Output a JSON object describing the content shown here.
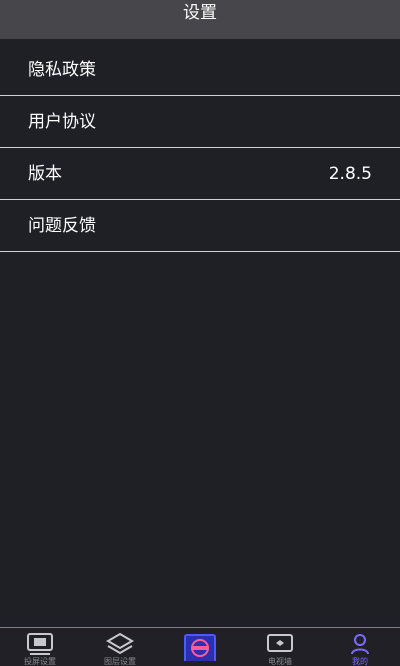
{
  "header": {
    "title": "设置"
  },
  "settings": {
    "items": [
      {
        "label": "隐私政策",
        "value": ""
      },
      {
        "label": "用户协议",
        "value": ""
      },
      {
        "label": "版本",
        "value": "2.8.5"
      },
      {
        "label": "问题反馈",
        "value": ""
      }
    ]
  },
  "tabbar": {
    "tabs": [
      {
        "label": "投屏设置",
        "icon": "screen-cast-icon",
        "active": false
      },
      {
        "label": "图层设置",
        "icon": "layers-icon",
        "active": false
      },
      {
        "label": "",
        "icon": "disc-button-icon",
        "active": false
      },
      {
        "label": "电视墙",
        "icon": "tv-wall-icon",
        "active": false
      },
      {
        "label": "我的",
        "icon": "person-icon",
        "active": true
      }
    ]
  },
  "colors": {
    "background": "#1f1f26",
    "header": "#46464b",
    "divider": "#cfcfd4",
    "tab_accent": "#2aa1a7",
    "active": "#7a6bff"
  }
}
